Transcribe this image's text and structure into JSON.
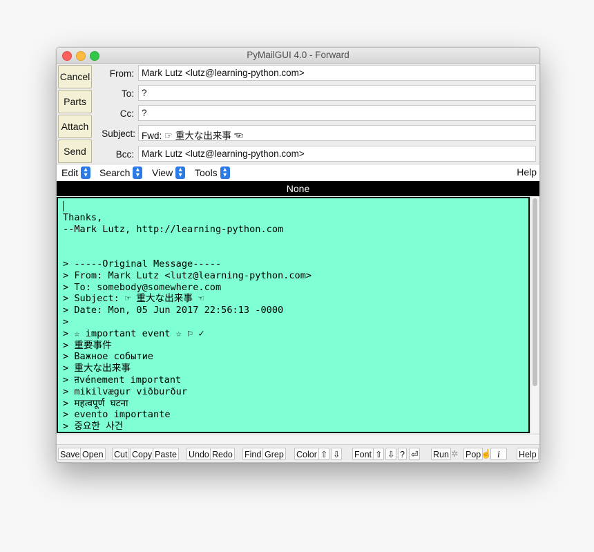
{
  "window": {
    "title": "PyMailGUI 4.0 - Forward"
  },
  "side_buttons": [
    "Cancel",
    "Parts",
    "Attach",
    "Send"
  ],
  "headers": {
    "from": {
      "label": "From:",
      "value": "Mark Lutz <lutz@learning-python.com>"
    },
    "to": {
      "label": "To:",
      "value": "?"
    },
    "cc": {
      "label": "Cc:",
      "value": "?"
    },
    "subject": {
      "label": "Subject:",
      "value": "Fwd: ☞ 重大な出来事 ☜"
    },
    "bcc": {
      "label": "Bcc:",
      "value": "Mark Lutz <lutz@learning-python.com>"
    }
  },
  "menus": [
    "Edit",
    "Search",
    "View",
    "Tools"
  ],
  "help_menu": "Help",
  "note_bar": "None",
  "editor_lines": [
    "",
    "Thanks,",
    "--Mark Lutz, http://learning-python.com",
    "",
    "",
    "> -----Original Message-----",
    "> From: Mark Lutz <lutz@learning-python.com>",
    "> To: somebody@somewhere.com",
    "> Subject: ☞ 重大な出来事 ☜",
    "> Date: Mon, 05 Jun 2017 22:56:13 -0000",
    ">",
    "> ☆ important event ☆ ⚐ ✓",
    "> 重要事件",
    "> Важное событие",
    "> 重大な出来事",
    "> ऩvénement important",
    "> mikilvægur viðburður",
    "> महत्वपूर्ण घटना",
    "> evento importante",
    "> 중요한 사건"
  ],
  "toolbar": {
    "save": "Save",
    "open": "Open",
    "cut": "Cut",
    "copy": "Copy",
    "paste": "Paste",
    "undo": "Undo",
    "redo": "Redo",
    "find": "Find",
    "grep": "Grep",
    "color": "Color",
    "font": "Font",
    "run": "Run",
    "pop": "Pop",
    "help": "Help",
    "up_arrow": "⇧",
    "down_arrow": "⇩",
    "question": "?",
    "return": "⏎",
    "gear": "✲",
    "pointer": "☝",
    "info": "i"
  },
  "colors": {
    "editor_background": "#7fffd4",
    "side_button_background": "#f4f0d6",
    "menu_chevron": "#2c7be5"
  }
}
